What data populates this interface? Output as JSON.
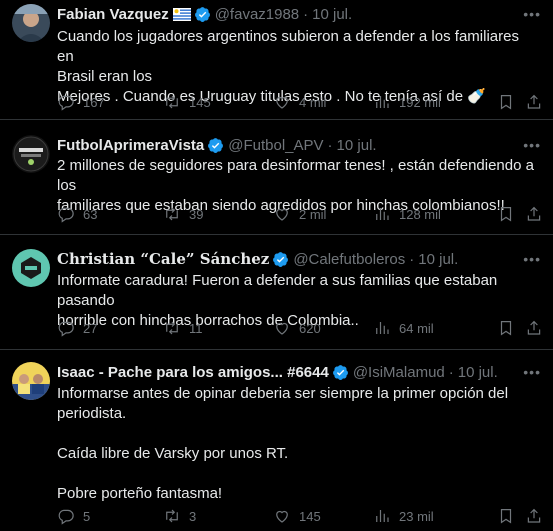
{
  "tweets": [
    {
      "name": "Fabian Vazquez",
      "handle": "@favaz1988",
      "date": "10 jul.",
      "lines": [
        "Cuando los jugadores argentinos subieron a defender a los familiares en",
        "Brasil eran los",
        "Mejores . Cuando es Uruguay titulas esto . No te tenía así de 🍼"
      ],
      "replies": "167",
      "retweets": "145",
      "likes": "4 mil",
      "views": "192 mil"
    },
    {
      "name": "FutbolAprimeraVista",
      "handle": "@Futbol_APV",
      "date": "10 jul.",
      "lines": [
        "2 millones de seguidores para desinformar tenes! , están defendiendo a los",
        "familiares que estaban siendo agredidos por hinchas colombianos!!"
      ],
      "replies": "63",
      "retweets": "39",
      "likes": "2 mil",
      "views": "128 mil"
    },
    {
      "name": "Christian “Cale” Sánchez",
      "handle": "@Calefutboleros",
      "date": "10 jul.",
      "lines": [
        "Informate caradura! Fueron a defender a sus familias que estaban pasando",
        "horrible con hinchas borrachos de Colombia.."
      ],
      "replies": "27",
      "retweets": "11",
      "likes": "620",
      "views": "64 mil"
    },
    {
      "name": "Isaac - Pache para los amigos... #6644",
      "handle": "@IsiMalamud",
      "date": "10 jul.",
      "lines": [
        "Informarse antes de opinar deberia ser siempre la primer opción del",
        "periodista.",
        "Caída libre de Varsky por unos RT.",
        "Pobre porteño fantasma!"
      ],
      "replies": "5",
      "retweets": "3",
      "likes": "145",
      "views": "23 mil"
    }
  ],
  "colors": {
    "background": "#000000",
    "text": "#e7e9ea",
    "muted": "#71767b",
    "divider": "#2f3336",
    "verified": "#1d9bf0"
  },
  "icons": [
    "more-icon",
    "reply-icon",
    "retweet-icon",
    "like-icon",
    "views-icon",
    "bookmark-icon",
    "share-icon",
    "verified-badge-icon",
    "uruguay-flag-icon"
  ]
}
